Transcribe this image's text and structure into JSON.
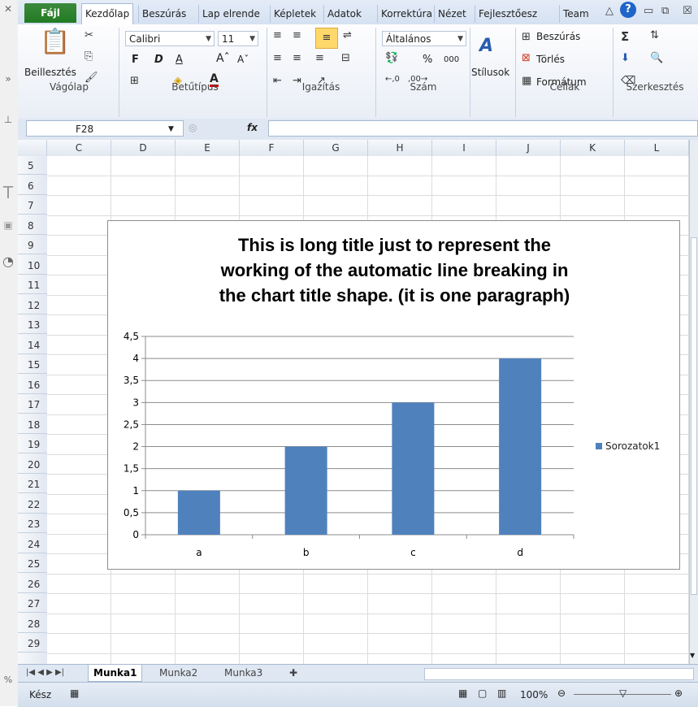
{
  "ribbon": {
    "tabs": [
      "Fájl",
      "Kezdőlap",
      "Beszúrás",
      "Lap elrende",
      "Képletek",
      "Adatok",
      "Korrektúra",
      "Nézet",
      "Fejlesztőesz",
      "Team"
    ],
    "paste_label": "Beillesztés",
    "font_name": "Calibri",
    "font_size": "11",
    "number_format": "Általános",
    "percent": "%",
    "thousands": "000",
    "styles_label": "Stílusok",
    "insert_label": "Beszúrás",
    "delete_label": "Törlés",
    "format_label": "Formátum",
    "groups": [
      "Vágólap",
      "Betűtípus",
      "Igazítás",
      "Szám",
      "Cellák",
      "Szerkesztés"
    ]
  },
  "formula_bar": {
    "name_box": "F28",
    "fx": "fx",
    "value": ""
  },
  "columns": [
    "C",
    "D",
    "E",
    "F",
    "G",
    "H",
    "I",
    "J",
    "K",
    "L"
  ],
  "rows": [
    "5",
    "6",
    "7",
    "8",
    "9",
    "10",
    "11",
    "12",
    "13",
    "14",
    "15",
    "16",
    "17",
    "18",
    "19",
    "20",
    "21",
    "22",
    "23",
    "24",
    "25",
    "26",
    "27",
    "28",
    "29"
  ],
  "chart_data": {
    "type": "bar",
    "title_lines": [
      "This is long title just to represent the",
      "working of the automatic line breaking in",
      "the chart title shape. (it is one paragraph)"
    ],
    "categories": [
      "a",
      "b",
      "c",
      "d"
    ],
    "series": [
      {
        "name": "Sorozatok1",
        "values": [
          1,
          2,
          3,
          4
        ],
        "color": "#4f81bd"
      }
    ],
    "ylim": [
      0,
      4.5
    ],
    "yticks": [
      "0",
      "0,5",
      "1",
      "1,5",
      "2",
      "2,5",
      "3",
      "3,5",
      "4",
      "4,5"
    ],
    "grid": true,
    "legend": "right"
  },
  "sheets": [
    "Munka1",
    "Munka2",
    "Munka3"
  ],
  "status": {
    "ready": "Kész",
    "zoom": "100%"
  }
}
